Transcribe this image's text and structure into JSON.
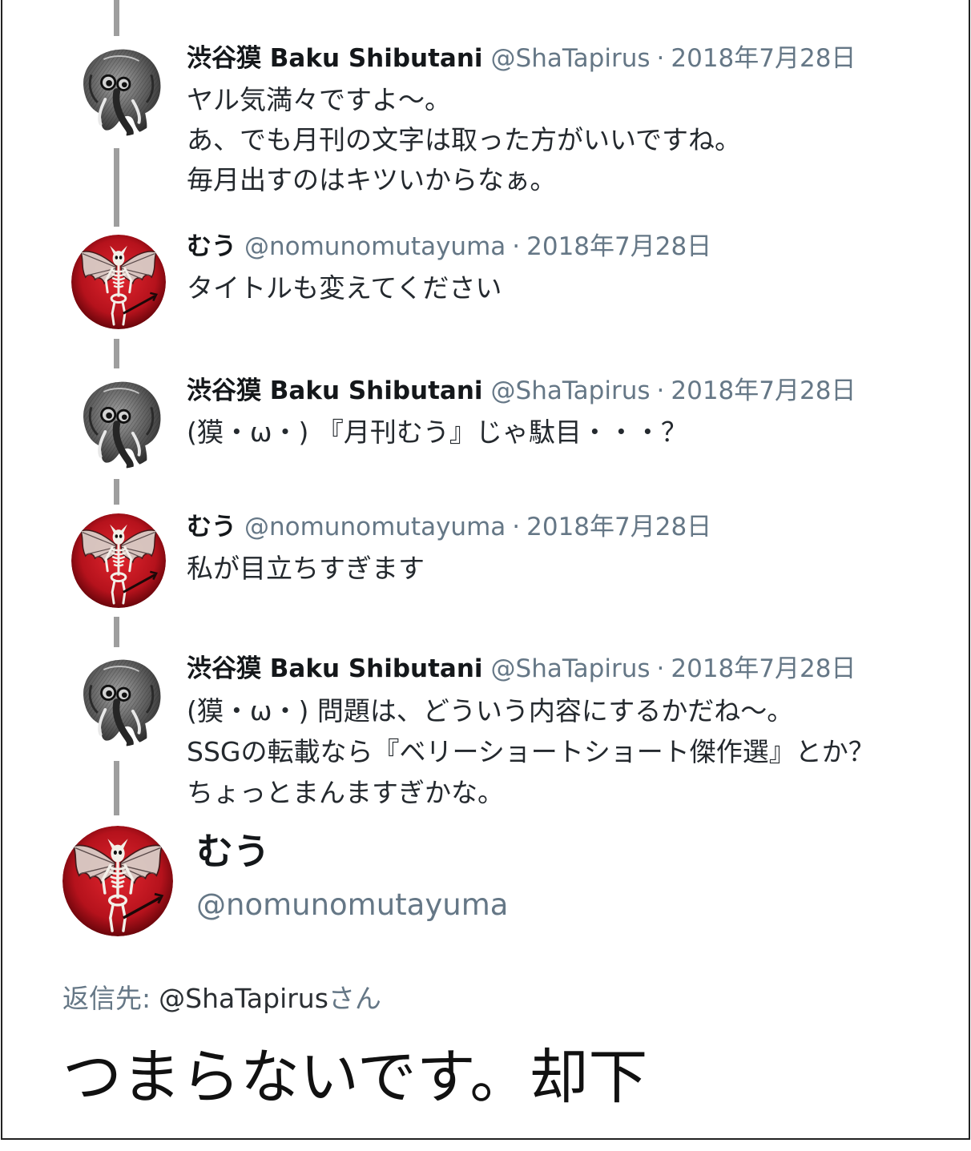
{
  "thread": [
    {
      "author_name": "渋谷獏 Baku Shibutani",
      "handle": "@ShaTapirus",
      "separator": "·",
      "date": "2018年7月28日",
      "avatar_icon": "tapir-sketch-avatar",
      "lines": [
        "ヤル気満々ですよ〜。",
        "あ、でも月刊の文字は取った方がいいですね。",
        "毎月出すのはキツいからなぁ。"
      ]
    },
    {
      "author_name": "むう",
      "handle": "@nomunomutayuma",
      "separator": "·",
      "date": "2018年7月28日",
      "avatar_icon": "winged-skeleton-avatar",
      "lines": [
        "タイトルも変えてください"
      ]
    },
    {
      "author_name": "渋谷獏 Baku Shibutani",
      "handle": "@ShaTapirus",
      "separator": "·",
      "date": "2018年7月28日",
      "avatar_icon": "tapir-sketch-avatar",
      "lines": [
        "(獏・ω・) 『月刊むう』じゃ駄目・・・？"
      ]
    },
    {
      "author_name": "むう",
      "handle": "@nomunomutayuma",
      "separator": "·",
      "date": "2018年7月28日",
      "avatar_icon": "winged-skeleton-avatar",
      "lines": [
        "私が目立ちすぎます"
      ]
    },
    {
      "author_name": "渋谷獏 Baku Shibutani",
      "handle": "@ShaTapirus",
      "separator": "·",
      "date": "2018年7月28日",
      "avatar_icon": "tapir-sketch-avatar",
      "lines": [
        "(獏・ω・) 問題は、どういう内容にするかだね〜。",
        "SSGの転載なら『ベリーショートショート傑作選』とか？",
        "ちょっとまんますぎかな。"
      ]
    }
  ],
  "main_tweet": {
    "author_name": "むう",
    "handle": "@nomunomutayuma",
    "avatar_icon": "winged-skeleton-avatar",
    "reply_prefix": "返信先:",
    "reply_to": "@ShaTapirus",
    "reply_suffix": "さん",
    "text": "つまらないです。却下"
  },
  "colors": {
    "text": "#14171a",
    "muted": "#657786",
    "body": "#24292e",
    "line": "#9e9e9e",
    "frame": "#222222",
    "avatar_red": "#b5121c"
  }
}
